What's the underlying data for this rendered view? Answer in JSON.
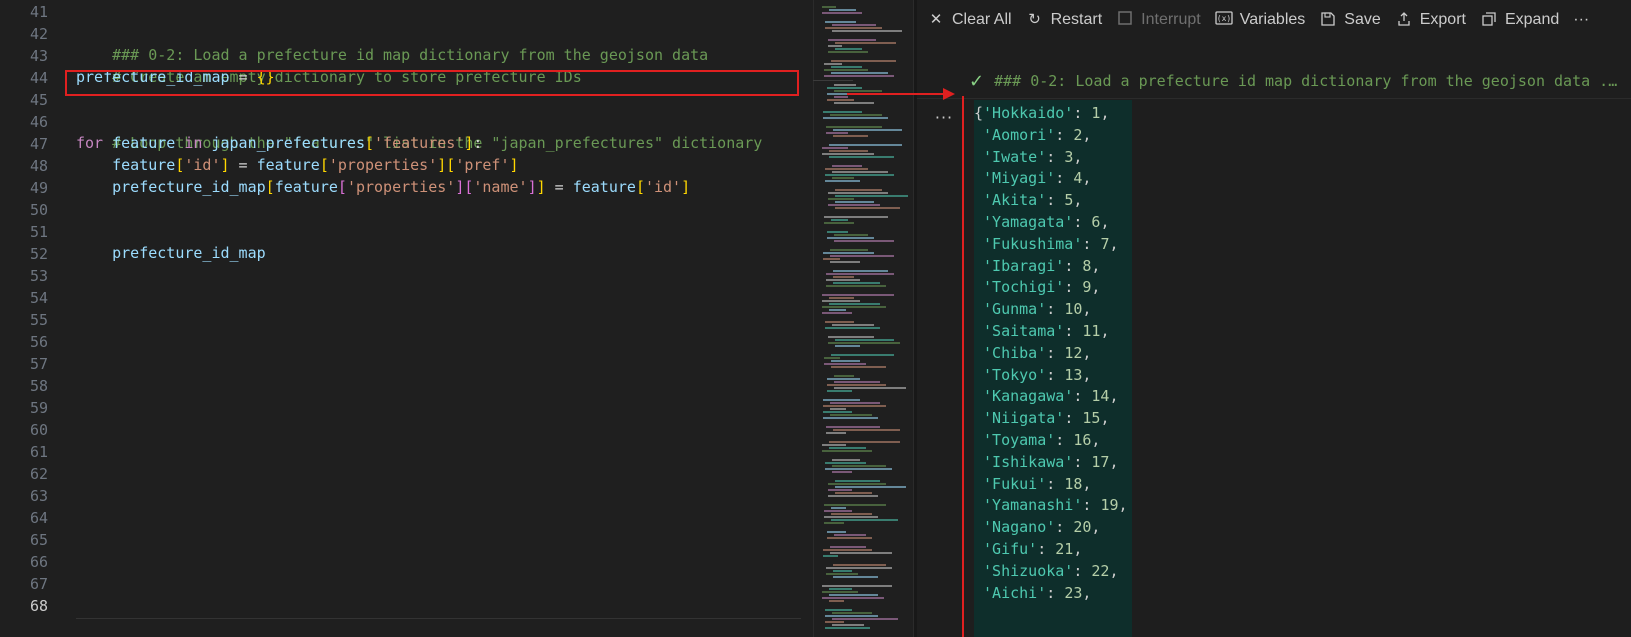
{
  "editor": {
    "line_numbers": [
      "41",
      "42",
      "43",
      "44",
      "45",
      "46",
      "47",
      "48",
      "49",
      "50",
      "51",
      "52",
      "53",
      "54",
      "55",
      "56",
      "57",
      "58",
      "59",
      "60",
      "61",
      "62",
      "63",
      "64",
      "65",
      "66",
      "67",
      "68"
    ],
    "active_line": "68",
    "code": {
      "l42": "### 0-2: Load a prefecture id map dictionary from the geojson data",
      "l43": "# Create an empty dictionary to store prefecture IDs",
      "l44_var": "prefecture_id_map",
      "l44_eq": " = ",
      "l44_val": "{}",
      "l46": "# Loop through the \"features\" list in the \"japan_prefectures\" dictionary",
      "l47_kw1": "for",
      "l47_var1": "feature",
      "l47_kw2": "in",
      "l47_var2": "japan_prefectures",
      "l47_key": "'features'",
      "l47_end": ":",
      "l48_var": "feature",
      "l48_key1": "'id'",
      "l48_eq": " = ",
      "l48_var2": "feature",
      "l48_key2": "'properties'",
      "l48_key3": "'pref'",
      "l49_var": "prefecture_id_map",
      "l49_var2": "feature",
      "l49_key1": "'properties'",
      "l49_key2": "'name'",
      "l49_eq": " = ",
      "l49_var3": "feature",
      "l49_key3": "'id'",
      "l51": "prefecture_id_map"
    }
  },
  "toolbar": {
    "clear_all": "Clear All",
    "restart": "Restart",
    "interrupt": "Interrupt",
    "variables": "Variables",
    "save": "Save",
    "export": "Export",
    "expand": "Expand",
    "more": "···"
  },
  "cell": {
    "title": "### 0-2: Load a prefecture id map dictionary from the geojson data ...",
    "status_icon": "check-icon",
    "more": "···"
  },
  "output": {
    "items": [
      {
        "name": "'Hokkaido'",
        "id": "1"
      },
      {
        "name": "'Aomori'",
        "id": "2"
      },
      {
        "name": "'Iwate'",
        "id": "3"
      },
      {
        "name": "'Miyagi'",
        "id": "4"
      },
      {
        "name": "'Akita'",
        "id": "5"
      },
      {
        "name": "'Yamagata'",
        "id": "6"
      },
      {
        "name": "'Fukushima'",
        "id": "7"
      },
      {
        "name": "'Ibaragi'",
        "id": "8"
      },
      {
        "name": "'Tochigi'",
        "id": "9"
      },
      {
        "name": "'Gunma'",
        "id": "10"
      },
      {
        "name": "'Saitama'",
        "id": "11"
      },
      {
        "name": "'Chiba'",
        "id": "12"
      },
      {
        "name": "'Tokyo'",
        "id": "13"
      },
      {
        "name": "'Kanagawa'",
        "id": "14"
      },
      {
        "name": "'Niigata'",
        "id": "15"
      },
      {
        "name": "'Toyama'",
        "id": "16"
      },
      {
        "name": "'Ishikawa'",
        "id": "17"
      },
      {
        "name": "'Fukui'",
        "id": "18"
      },
      {
        "name": "'Yamanashi'",
        "id": "19"
      },
      {
        "name": "'Nagano'",
        "id": "20"
      },
      {
        "name": "'Gifu'",
        "id": "21"
      },
      {
        "name": "'Shizuoka'",
        "id": "22"
      },
      {
        "name": "'Aichi'",
        "id": "23"
      }
    ]
  },
  "colors": {
    "annotation": "#e02020",
    "output_bg": "#0e2e2b",
    "string": "#4ec9b0",
    "number": "#b5cea8"
  }
}
